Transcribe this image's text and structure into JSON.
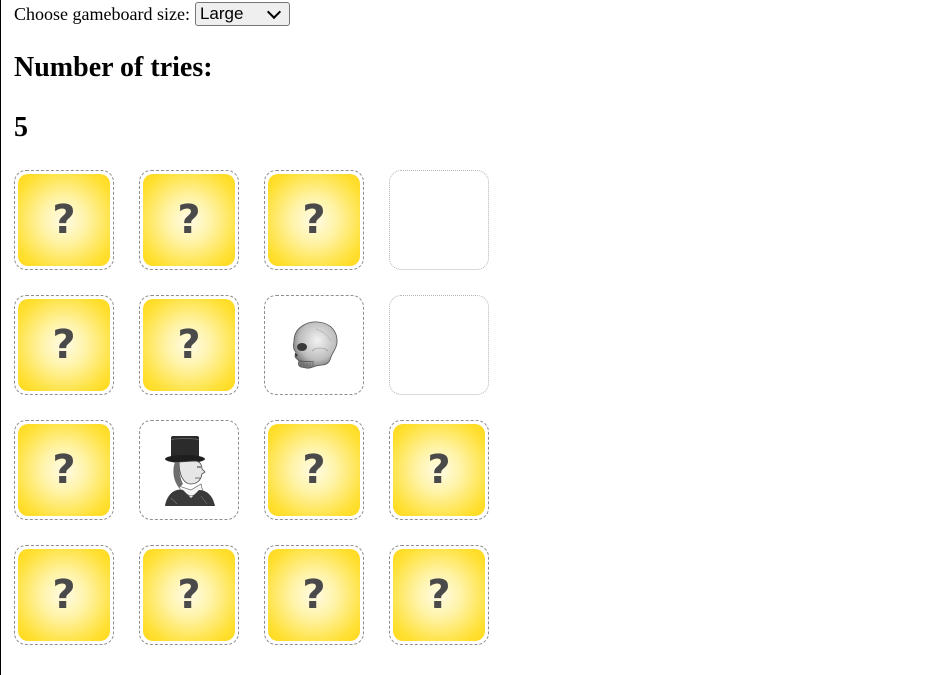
{
  "controls": {
    "label": "Choose gameboard size:",
    "selected": "Large"
  },
  "title": "Number of tries:",
  "tries": "5",
  "board": {
    "unrevealed_symbol": "?",
    "cards": [
      {
        "state": "hidden"
      },
      {
        "state": "hidden"
      },
      {
        "state": "hidden"
      },
      {
        "state": "matched"
      },
      {
        "state": "hidden"
      },
      {
        "state": "hidden"
      },
      {
        "state": "revealed",
        "image": "skull-icon"
      },
      {
        "state": "matched"
      },
      {
        "state": "hidden"
      },
      {
        "state": "revealed",
        "image": "top-hat-man-icon"
      },
      {
        "state": "hidden"
      },
      {
        "state": "hidden"
      },
      {
        "state": "hidden"
      },
      {
        "state": "hidden"
      },
      {
        "state": "hidden"
      },
      {
        "state": "hidden"
      }
    ]
  },
  "colors": {
    "card_face": "#ffe033",
    "card_center": "#fffbe6",
    "question_mark": "#4a4a4a"
  }
}
